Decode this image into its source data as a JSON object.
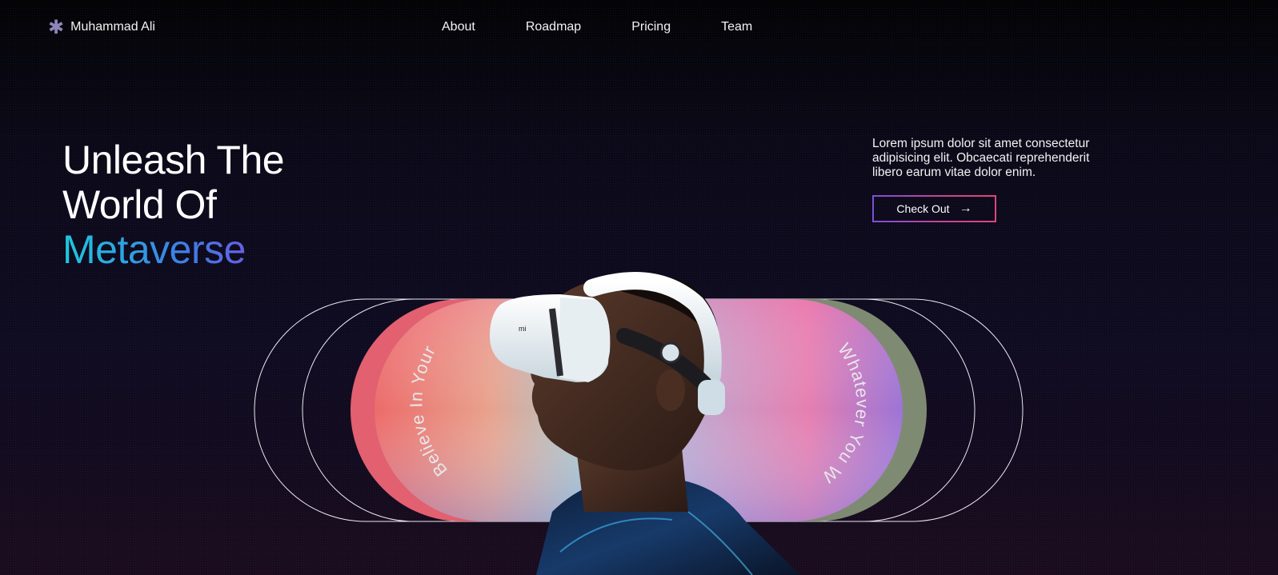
{
  "brand": {
    "icon": "asterisk-icon",
    "name": "Muhammad Ali"
  },
  "nav": {
    "links": [
      "About",
      "Roadmap",
      "Pricing",
      "Team"
    ]
  },
  "hero": {
    "title_line1": "Unleash The",
    "title_line2": "World Of",
    "title_accent": "Metaverse",
    "description": "Lorem ipsum dolor sit amet consectetur adipisicing elit. Obcaecati reprehenderit libero earum vitae dolor enim.",
    "cta_label": "Check Out",
    "cta_icon": "arrow-right-icon"
  },
  "art": {
    "left_curve_text": "Believe In Yourself",
    "right_curve_text": "Whatever You Want"
  },
  "colors": {
    "accent_start": "#1ec7dd",
    "accent_end": "#7b4ee0",
    "cta_border": "#e0467a"
  }
}
